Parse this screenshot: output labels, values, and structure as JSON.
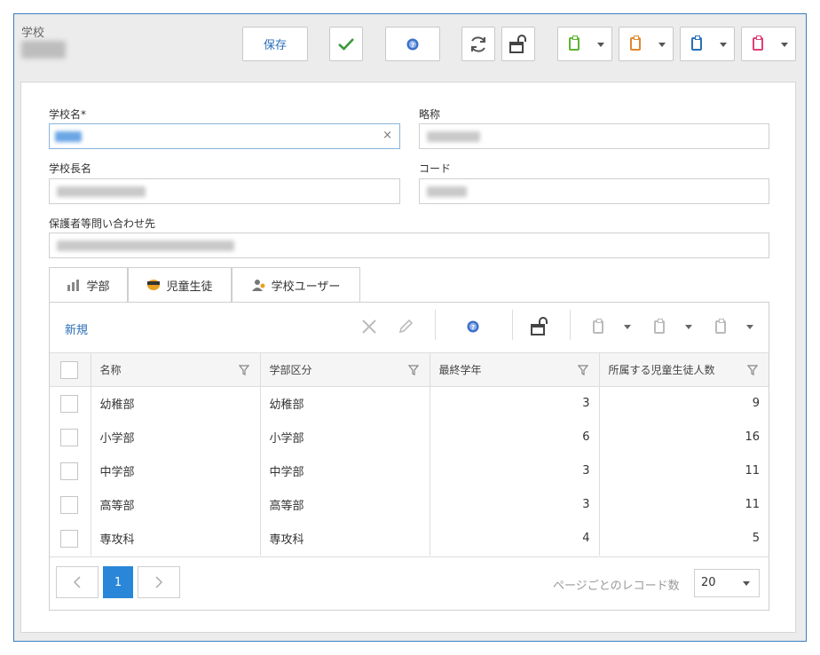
{
  "header": {
    "title": "学校",
    "save_label": "保存"
  },
  "form": {
    "school_name_label": "学校名*",
    "abbreviation_label": "略称",
    "principal_label": "学校長名",
    "code_label": "コード",
    "guardian_contact_label": "保護者等問い合わせ先",
    "clear_symbol": "×"
  },
  "tabs": [
    {
      "label": "学部",
      "icon": "bar-chart-icon"
    },
    {
      "label": "児童生徒",
      "icon": "student-icon"
    },
    {
      "label": "学校ユーザー",
      "icon": "users-icon"
    }
  ],
  "grid": {
    "new_label": "新規",
    "columns": [
      "名称",
      "学部区分",
      "最終学年",
      "所属する児童生徒人数"
    ],
    "rows": [
      {
        "name": "幼稚部",
        "category": "幼稚部",
        "final_grade": "3",
        "students": "9"
      },
      {
        "name": "小学部",
        "category": "小学部",
        "final_grade": "6",
        "students": "16"
      },
      {
        "name": "中学部",
        "category": "中学部",
        "final_grade": "3",
        "students": "11"
      },
      {
        "name": "高等部",
        "category": "高等部",
        "final_grade": "3",
        "students": "11"
      },
      {
        "name": "専攻科",
        "category": "専攻科",
        "final_grade": "4",
        "students": "5"
      }
    ]
  },
  "pager": {
    "current_page": "1",
    "records_label": "ページごとのレコード数",
    "page_size": "20"
  },
  "colors": {
    "accent": "#2a86d8",
    "link": "#2a6fb8",
    "check_green": "#3a9a3a",
    "clip_green": "#5cb531",
    "clip_orange": "#e08a2c",
    "clip_blue": "#2a6fb8",
    "clip_pink": "#e0407a"
  }
}
